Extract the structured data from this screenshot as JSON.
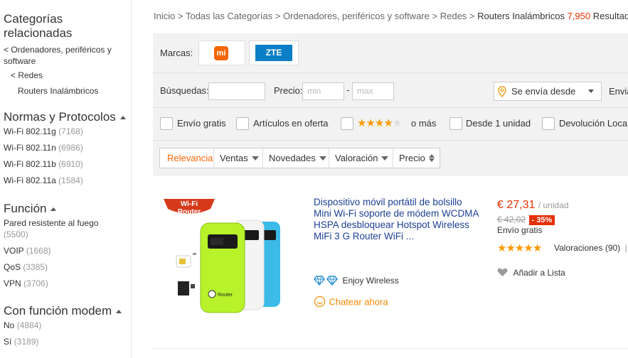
{
  "sidebar": {
    "heading": "Categorías relacionadas",
    "links": [
      "< Ordenadores, periféricos y software",
      "< Redes",
      "Routers Inalámbricos"
    ],
    "groups": [
      {
        "title": "Normas y Protocolos",
        "items": [
          {
            "label": "Wi-Fi 802.11g",
            "count": "(7168)"
          },
          {
            "label": "Wi-Fi 802.11n",
            "count": "(6986)"
          },
          {
            "label": "Wi-Fi 802.11b",
            "count": "(6910)"
          },
          {
            "label": "Wi-Fi 802.11a",
            "count": "(1584)"
          }
        ]
      },
      {
        "title": "Función",
        "items": [
          {
            "label": "Pared resistente al fuego",
            "count": "(5500)"
          },
          {
            "label": "VOIP",
            "count": "(1668)"
          },
          {
            "label": "QoS",
            "count": "(3385)"
          },
          {
            "label": "VPN",
            "count": "(3706)"
          }
        ]
      },
      {
        "title": "Con función modem",
        "items": [
          {
            "label": "No",
            "count": "(4884)"
          },
          {
            "label": "Sí",
            "count": "(3189)"
          }
        ]
      }
    ]
  },
  "breadcrumb": {
    "parts": [
      "Inicio",
      "Todas las Categorías",
      "Ordenadores, periféricos y software",
      "Redes",
      "Routers Inalámbricos"
    ],
    "separator": ">",
    "count": "7,950",
    "suffix": "Resultados"
  },
  "filters": {
    "brands_label": "Marcas:",
    "brands": [
      "mi",
      "ZTE"
    ],
    "search_label": "Búsquedas:",
    "price_label": "Precio:",
    "price_min_placeholder": "min",
    "price_dash": "-",
    "price_max_placeholder": "max",
    "ships_from": "Se envía desde",
    "ships_to_cut": "Envia",
    "checkboxes": [
      "Envío gratis",
      "Artículos en oferta",
      "o más",
      "Desde 1 unidad",
      "Devolución Local"
    ],
    "rating_stars": 4
  },
  "sort": {
    "items": [
      "Relevancia",
      "Ventas",
      "Novedades",
      "Valoración",
      "Precio"
    ]
  },
  "product": {
    "badge_line1": "Wi-Fi",
    "badge_line2": "Router",
    "device_brand": "Router",
    "title": "Dispositivo móvil portátil de bolsillo Mini Wi-Fi soporte de módem WCDMA HSPA desbloquear Hotspot Wireless MiFi 3 G Router WiFi ...",
    "store": "Enjoy Wireless",
    "chat": "Chatear ahora",
    "price": "€ 27,31",
    "unit": "/ unidad",
    "old_price": "€ 42,02",
    "discount": "- 35%",
    "shipping": "Envío gratis",
    "rating_stars": 5,
    "reviews": "Valoraciones (90)",
    "reviews_sep": "|",
    "wishlist": "Añadir a Lista"
  },
  "colors": {
    "accent": "#ff6600",
    "price": "#e62e04",
    "link": "#1c3f95",
    "zte": "#0a7fc7",
    "mi": "#f56600",
    "star": "#ff9900"
  }
}
